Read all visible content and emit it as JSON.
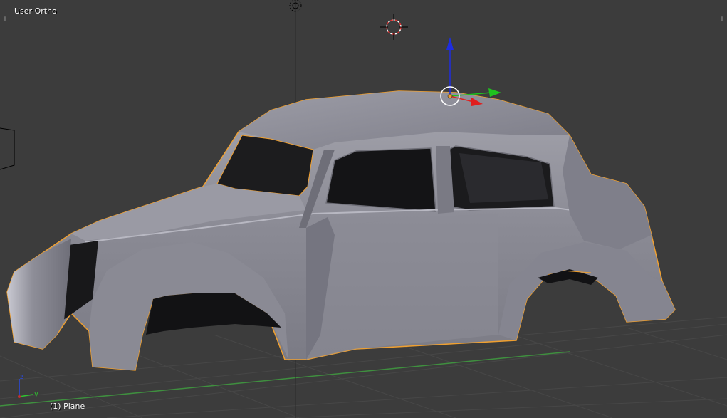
{
  "viewport": {
    "view_name": "User Ortho",
    "object_info": "(1) Plane",
    "corner_widget_glyph": "+"
  },
  "axis_gizmo": {
    "z_label": "z",
    "y_label": "y"
  },
  "colors": {
    "background": "#3c3c3c",
    "grid": "#4a4a4a",
    "axis_x": "#9a3a3a",
    "axis_y": "#3f8f3f",
    "selection_outline": "#f0a030",
    "mesh_body": "#8e8e98",
    "manipulator_z": "#1e2de0",
    "manipulator_y": "#1fc21f",
    "manipulator_x": "#e01e1e"
  },
  "scene": {
    "object_type": "car body mesh",
    "selected": true
  }
}
